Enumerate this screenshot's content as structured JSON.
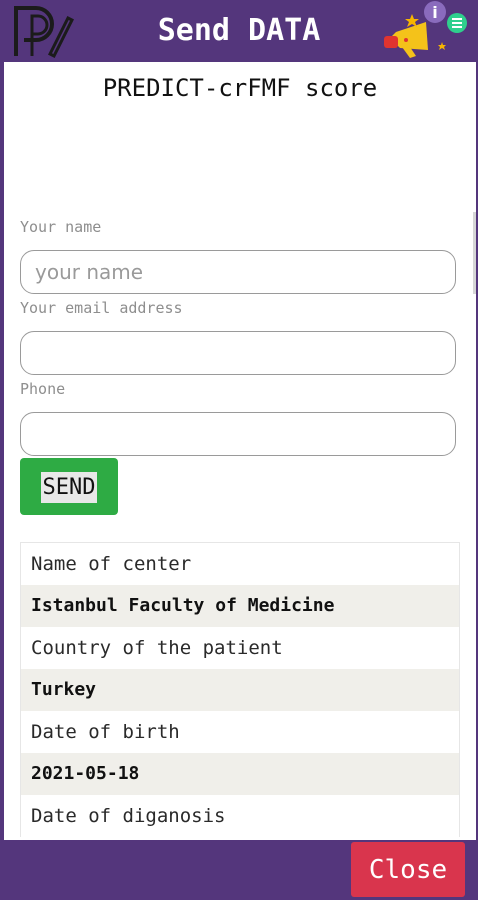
{
  "header": {
    "title": "Send DATA",
    "logo_icon": "app-logo-icon",
    "promo_icon": "megaphone-icon"
  },
  "form": {
    "card_title": "PREDICT-crFMF score",
    "name_label": "Your name",
    "name_placeholder": "your name",
    "name_value": "",
    "email_label": "Your email address",
    "email_value": "",
    "phone_label": "Phone",
    "phone_value": "",
    "send_label": "SEND"
  },
  "table": {
    "rows": [
      {
        "text": "Name of center",
        "kind": "label"
      },
      {
        "text": "Istanbul Faculty of Medicine",
        "kind": "value"
      },
      {
        "text": "Country of the patient",
        "kind": "label"
      },
      {
        "text": "Turkey",
        "kind": "value"
      },
      {
        "text": "Date of birth",
        "kind": "label"
      },
      {
        "text": "2021-05-18",
        "kind": "value"
      },
      {
        "text": "Date of diganosis",
        "kind": "label"
      }
    ]
  },
  "footer": {
    "close_label": "Close"
  },
  "colors": {
    "primary": "#54367c",
    "send": "#2eab44",
    "close": "#d9354d"
  }
}
